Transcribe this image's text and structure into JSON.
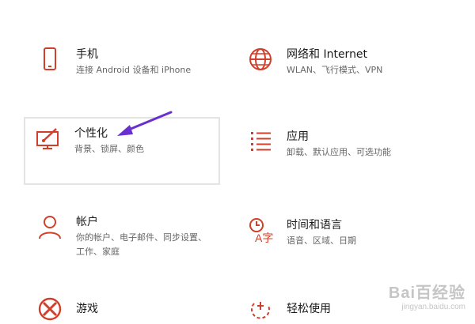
{
  "colors": {
    "accent": "#d13f2b",
    "arrow": "#6a2fd1",
    "hover_border": "#e3e3e3"
  },
  "settings": [
    {
      "name": "phone",
      "icon": "phone-icon",
      "title": "手机",
      "desc": "连接 Android 设备和 iPhone"
    },
    {
      "name": "network",
      "icon": "globe-icon",
      "title": "网络和 Internet",
      "desc": "WLAN、飞行模式、VPN"
    },
    {
      "name": "personalization",
      "icon": "personalization-icon",
      "title": "个性化",
      "desc": "背景、锁屏、颜色"
    },
    {
      "name": "apps",
      "icon": "apps-list-icon",
      "title": "应用",
      "desc": "卸载、默认应用、可选功能"
    },
    {
      "name": "accounts",
      "icon": "person-icon",
      "title": "帐户",
      "desc": "你的帐户、电子邮件、同步设置、工作、家庭"
    },
    {
      "name": "time-language",
      "icon": "time-language-icon",
      "title": "时间和语言",
      "desc": "语音、区域、日期"
    },
    {
      "name": "gaming",
      "icon": "xbox-icon",
      "title": "游戏",
      "desc": ""
    },
    {
      "name": "ease-of-access",
      "icon": "ease-of-access-icon",
      "title": "轻松使用",
      "desc": ""
    }
  ],
  "watermark": {
    "logo": "Bai百经验",
    "url": "jingyan.baidu.com"
  }
}
